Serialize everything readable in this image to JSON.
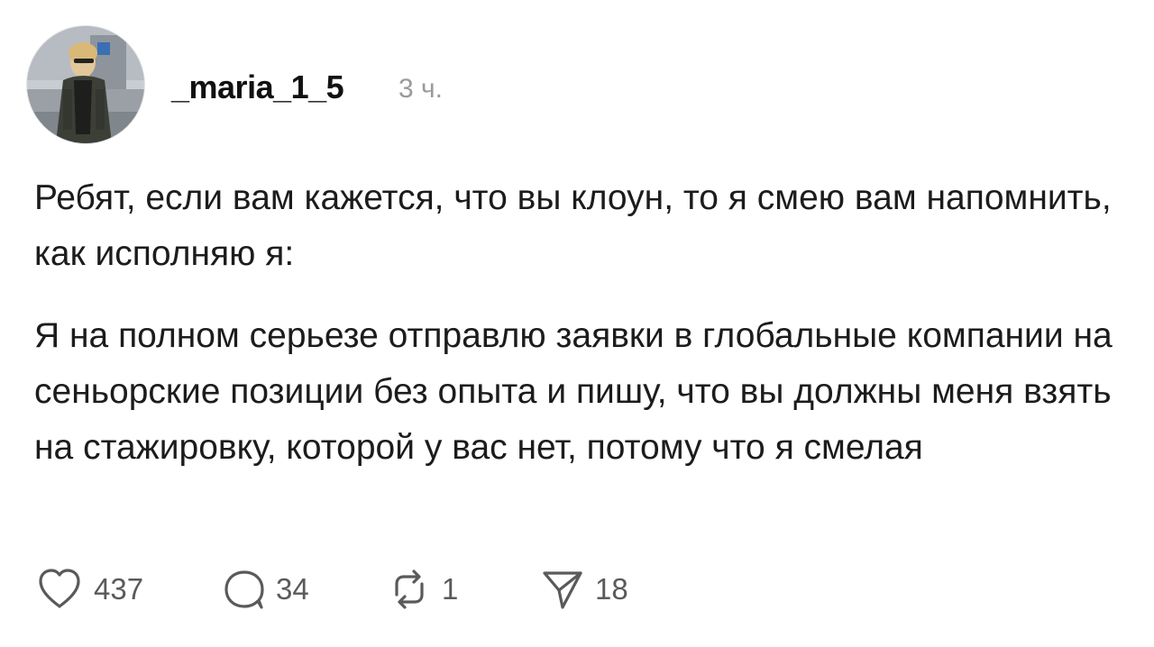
{
  "post": {
    "author": {
      "username": "_maria_1_5",
      "avatar_icon": "user-photo-avatar"
    },
    "timestamp": "3 ч.",
    "paragraphs": [
      "Ребят, если вам кажется, что вы клоун, то я смею вам напомнить, как исполняю я:",
      "Я на полном серьезе отправлю заявки в глобальные компании на сеньорские позиции без опыта и пишу, что вы должны меня взять на стажировку, которой у вас нет, потому что я смелая"
    ],
    "actions": {
      "likes": "437",
      "comments": "34",
      "reposts": "1",
      "shares": "18"
    },
    "icons": {
      "like": "heart-icon",
      "comment": "comment-bubble-icon",
      "repost": "repost-icon",
      "share": "send-icon"
    },
    "colors": {
      "text": "#1c1c1c",
      "muted": "#9a9a9a",
      "icon": "#5a5a5a"
    }
  }
}
